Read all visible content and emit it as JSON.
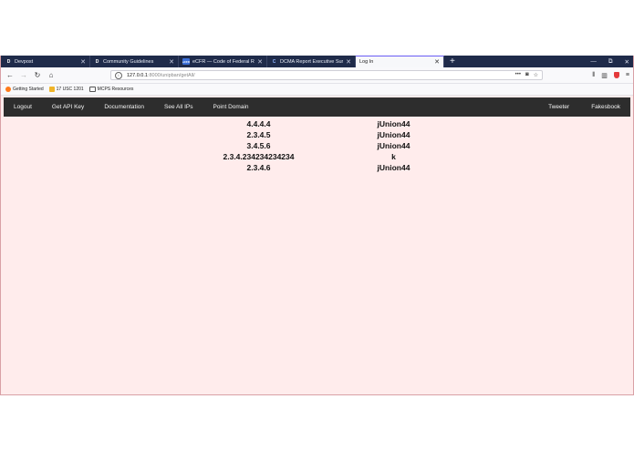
{
  "browser": {
    "tabs": [
      {
        "icon": "D",
        "title": "Devpost",
        "active": false,
        "icon_color": "#1a1a1a"
      },
      {
        "icon": "D",
        "title": "Community Guidelines",
        "active": false,
        "icon_color": "#1a1a1a"
      },
      {
        "icon": "eCFR",
        "title": "eCFR — Code of Federal Regul",
        "active": false,
        "icon_color": "#3b6fd8"
      },
      {
        "icon": "C",
        "title": "DCMA Report Executive Summ",
        "active": false,
        "icon_color": "#2a6fd6"
      },
      {
        "icon": "",
        "title": "Log In",
        "active": true,
        "icon_color": ""
      }
    ],
    "new_tab_glyph": "+",
    "window_controls": [
      "—",
      "⧉",
      "✕"
    ],
    "url": {
      "host": "127.0.0.1",
      "path": ":8000/unipban/getAll/"
    },
    "bookmarks": [
      {
        "label": "Getting Started",
        "icon": "firefox-icon"
      },
      {
        "label": "17 USC 1201",
        "icon": "bookmark-icon"
      },
      {
        "label": "MCPS Resources",
        "icon": "folder-icon"
      }
    ]
  },
  "site_nav": {
    "left": [
      "Logout",
      "Get API Key",
      "Documentation",
      "See All IPs",
      "Point Domain"
    ],
    "right": [
      "Tweeter",
      "Fakesbook"
    ]
  },
  "ip_table": [
    {
      "ip": "4.4.4.4",
      "user": "jUnion44"
    },
    {
      "ip": "2.3.4.5",
      "user": "jUnion44"
    },
    {
      "ip": "3.4.5.6",
      "user": "jUnion44"
    },
    {
      "ip": "2.3.4.234234234234",
      "user": "k"
    },
    {
      "ip": "2.3.4.6",
      "user": "jUnion44"
    }
  ]
}
